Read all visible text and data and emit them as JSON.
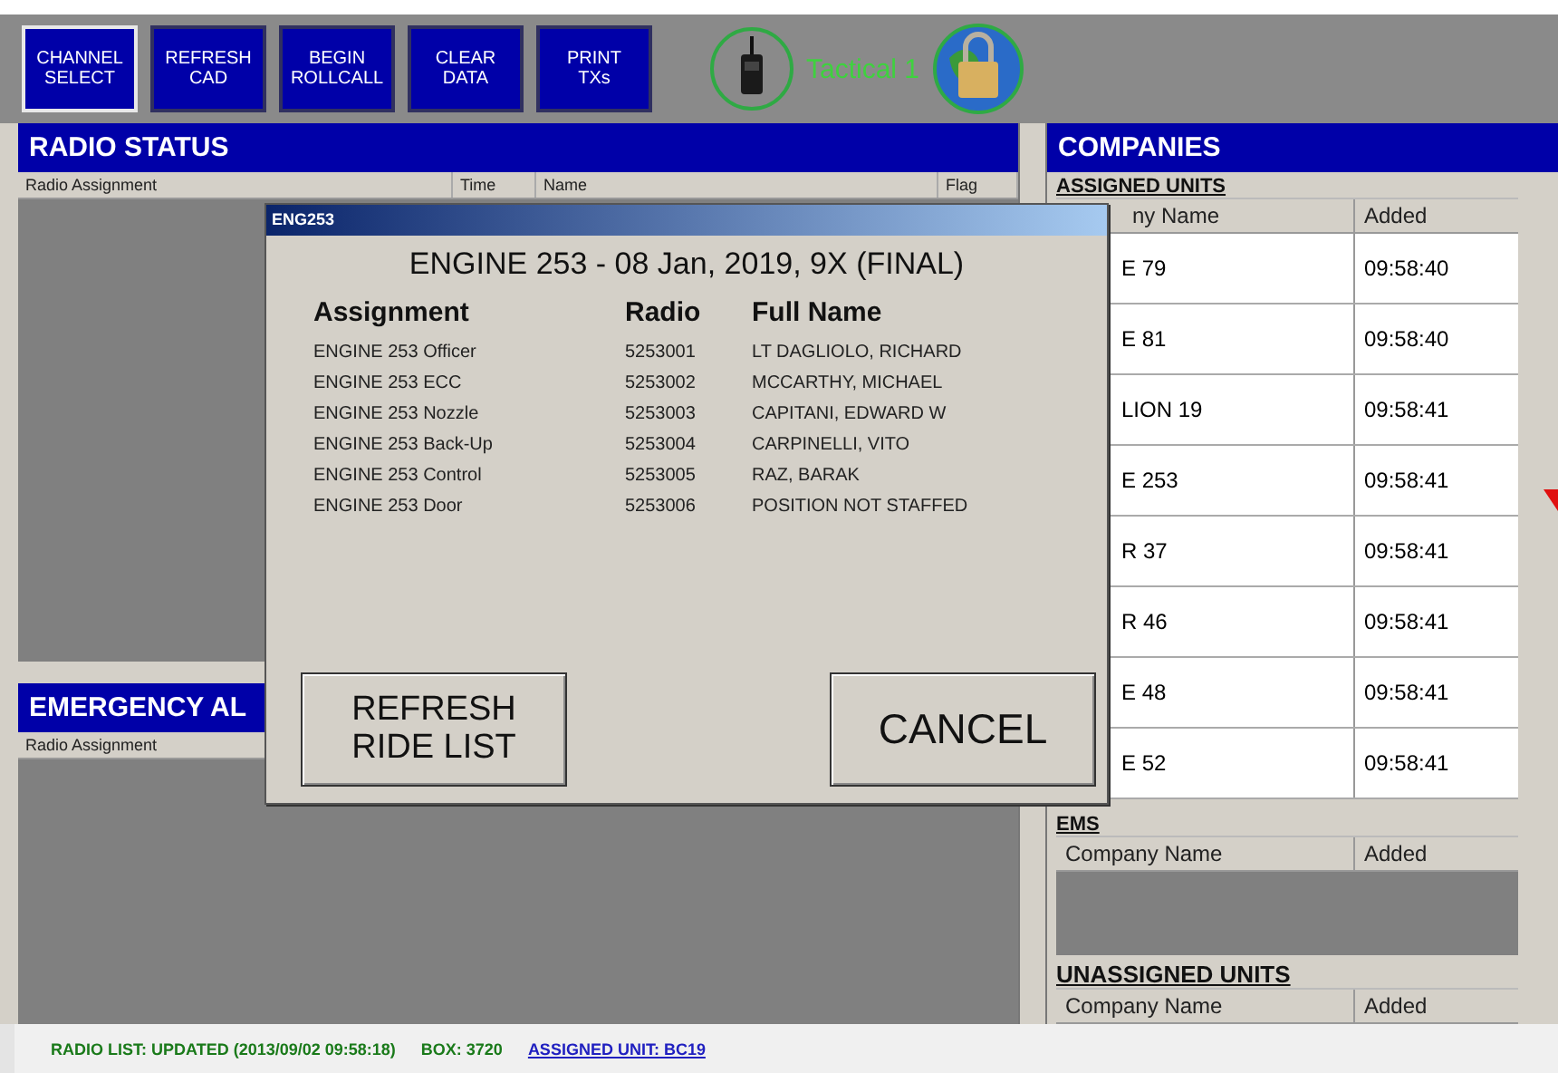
{
  "toolbar": {
    "buttons": [
      {
        "label": "CHANNEL SELECT",
        "selected": true
      },
      {
        "label": "REFRESH CAD",
        "selected": false
      },
      {
        "label": "BEGIN ROLLCALL",
        "selected": false
      },
      {
        "label": "CLEAR DATA",
        "selected": false
      },
      {
        "label": "PRINT TXs",
        "selected": false
      }
    ],
    "channel": {
      "label": "Tactical 1"
    }
  },
  "radio_status": {
    "title": "RADIO STATUS",
    "columns": [
      "Radio Assignment",
      "Time",
      "Name",
      "Flag"
    ]
  },
  "emergency_alerts": {
    "title": "EMERGENCY AL",
    "columns": [
      "Radio Assignment"
    ]
  },
  "companies": {
    "title": "COMPANIES",
    "assigned_units": {
      "label": "ASSIGNED UNITS",
      "columns": [
        "ny Name",
        "Added"
      ],
      "rows": [
        {
          "company": "E 79",
          "added": "09:58:40"
        },
        {
          "company": "E 81",
          "added": "09:58:40"
        },
        {
          "company": "LION 19",
          "added": "09:58:41"
        },
        {
          "company": "E 253",
          "added": "09:58:41"
        },
        {
          "company": "R 37",
          "added": "09:58:41"
        },
        {
          "company": "R 46",
          "added": "09:58:41"
        },
        {
          "company": "E 48",
          "added": "09:58:41"
        },
        {
          "company": "E 52",
          "added": "09:58:41"
        }
      ]
    },
    "ems": {
      "label": "EMS",
      "columns": [
        "Company Name",
        "Added"
      ]
    },
    "unassigned_units": {
      "label": "UNASSIGNED UNITS",
      "columns": [
        "Company Name",
        "Added"
      ]
    }
  },
  "dialog": {
    "title": "ENG253",
    "heading": "ENGINE 253 - 08 Jan, 2019, 9X (FINAL)",
    "columns": [
      "Assignment",
      "Radio",
      "Full Name"
    ],
    "rows": [
      {
        "assignment": "ENGINE 253 Officer",
        "radio": "5253001",
        "full_name": "LT DAGLIOLO, RICHARD"
      },
      {
        "assignment": "ENGINE 253 ECC",
        "radio": "5253002",
        "full_name": "MCCARTHY, MICHAEL"
      },
      {
        "assignment": "ENGINE 253 Nozzle",
        "radio": "5253003",
        "full_name": "CAPITANI, EDWARD W"
      },
      {
        "assignment": "ENGINE 253 Back-Up",
        "radio": "5253004",
        "full_name": "CARPINELLI, VITO"
      },
      {
        "assignment": "ENGINE 253 Control",
        "radio": "5253005",
        "full_name": "RAZ, BARAK"
      },
      {
        "assignment": "ENGINE 253 Door",
        "radio": "5253006",
        "full_name": "POSITION NOT STAFFED"
      }
    ],
    "buttons": [
      "REFRESH RIDE LIST",
      "CANCEL"
    ]
  },
  "status_bar": {
    "radio_list": "RADIO LIST:  UPDATED (2013/09/02 09:58:18)",
    "box": "BOX:  3720",
    "assigned_unit": "ASSIGNED UNIT:  BC19"
  }
}
